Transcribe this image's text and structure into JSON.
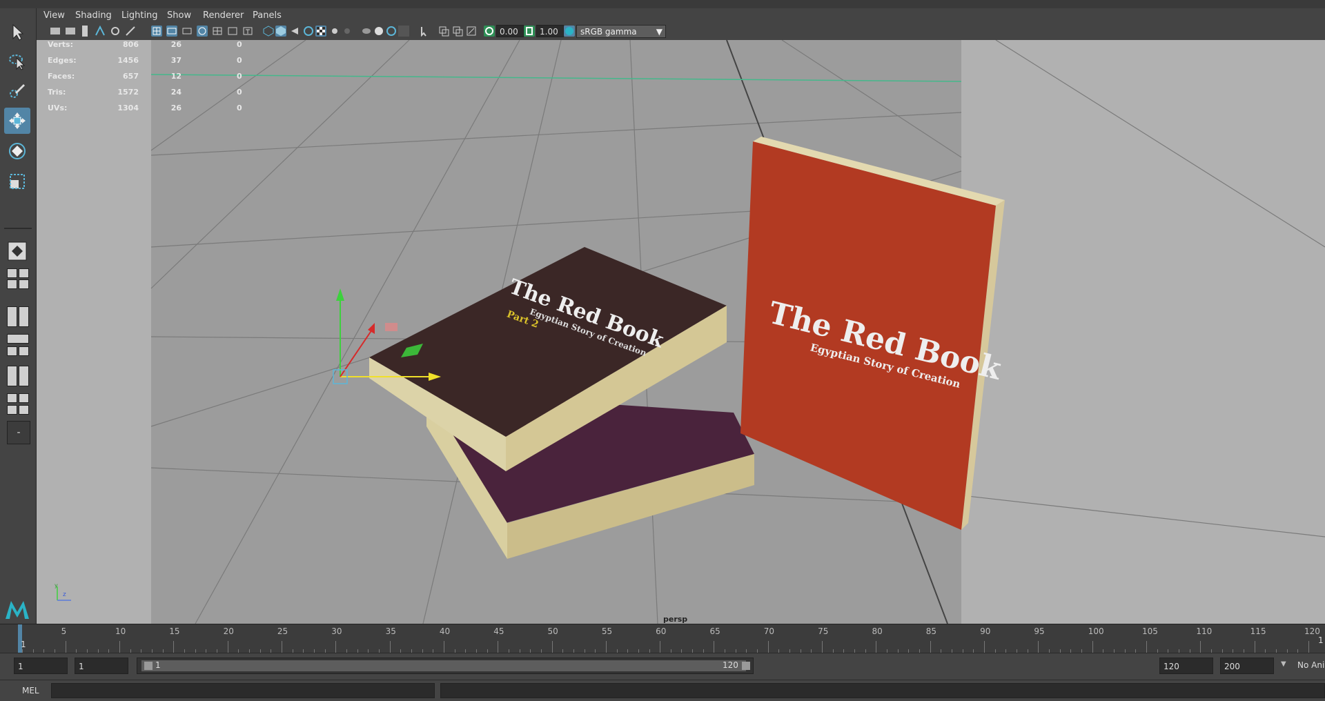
{
  "menu": [
    "View",
    "Shading",
    "Lighting",
    "Show",
    "Renderer",
    "Panels"
  ],
  "toolbar": {
    "exposure": "0.00",
    "gamma": "1.00",
    "color_space": "sRGB gamma"
  },
  "hud": {
    "rows": [
      {
        "label": "Verts:",
        "a": "806",
        "b": "26",
        "c": "0"
      },
      {
        "label": "Edges:",
        "a": "1456",
        "b": "37",
        "c": "0"
      },
      {
        "label": "Faces:",
        "a": "657",
        "b": "12",
        "c": "0"
      },
      {
        "label": "Tris:",
        "a": "1572",
        "b": "24",
        "c": "0"
      },
      {
        "label": "UVs:",
        "a": "1304",
        "b": "26",
        "c": "0"
      }
    ]
  },
  "viewport": {
    "camera": "persp",
    "axis_labels": {
      "y": "y",
      "z": "z"
    },
    "book_left": {
      "title": "The Red Book",
      "subtitle": "Egyptian Story of Creation",
      "part": "Part 2"
    },
    "book_right": {
      "title": "The Red Book",
      "subtitle": "Egyptian Story of Creation"
    }
  },
  "timeline": {
    "current_frame": "1",
    "ticks": [
      "5",
      "10",
      "15",
      "20",
      "25",
      "30",
      "35",
      "40",
      "45",
      "50",
      "55",
      "60",
      "65",
      "70",
      "75",
      "80",
      "85",
      "90",
      "95",
      "100",
      "105",
      "110",
      "115",
      "120"
    ],
    "right_frame": "1"
  },
  "range": {
    "start": "1",
    "playback_start": "1",
    "slider_start": "1",
    "slider_end": "120",
    "playback_end": "120",
    "end": "200",
    "anim_layer": "No Ani"
  },
  "command": {
    "lang": "MEL"
  },
  "colors": {
    "accent": "#5285a6",
    "viewport_bg": "#a1a1a1",
    "book_red": "#b23a22",
    "book_dark": "#3b2726"
  }
}
